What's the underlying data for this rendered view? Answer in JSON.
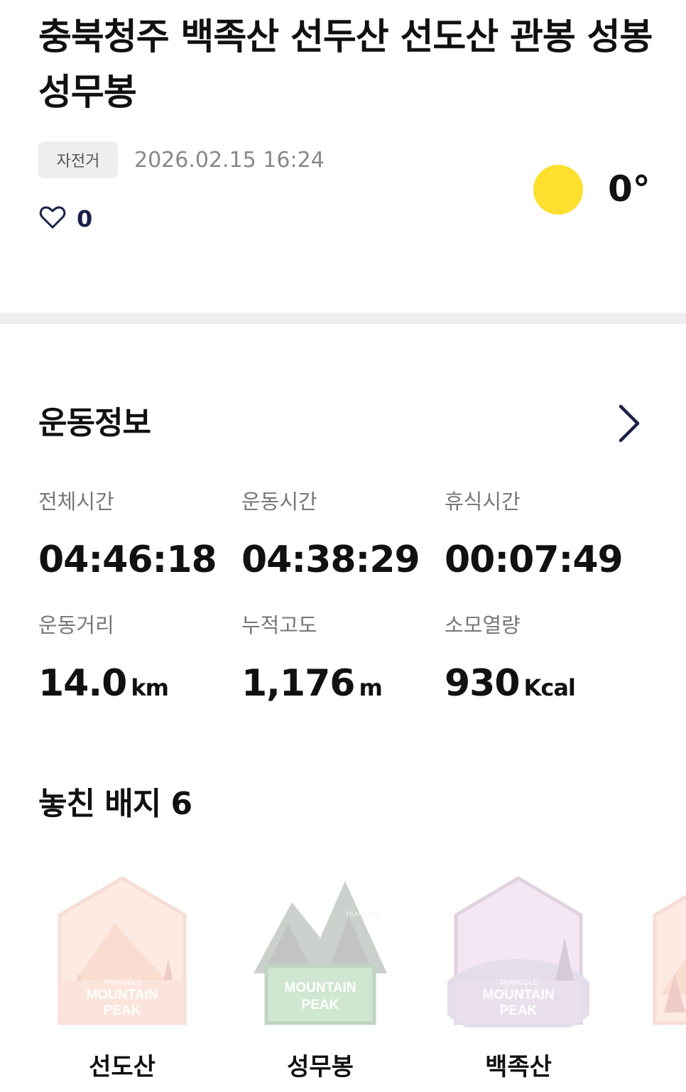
{
  "header": {
    "title": "충북청주 백족산 선두산 선도산 관봉 성봉 성무봉",
    "activity_tag": "자전거",
    "datetime": "2026.02.15 16:24",
    "likes": "0",
    "like_icon": "heart-outline-icon"
  },
  "weather": {
    "icon": "sun-icon",
    "icon_color": "#fde02e",
    "temperature": "0°"
  },
  "exercise_info": {
    "title": "운동정보",
    "more_icon": "chevron-right-icon",
    "accent_color": "#1a2148",
    "stats": [
      {
        "label": "전체시간",
        "value": "04:46:18",
        "unit": ""
      },
      {
        "label": "운동시간",
        "value": "04:38:29",
        "unit": ""
      },
      {
        "label": "휴식시간",
        "value": "00:07:49",
        "unit": ""
      },
      {
        "label": "운동거리",
        "value": "14.0",
        "unit": "km"
      },
      {
        "label": "누적고도",
        "value": "1,176",
        "unit": "m"
      },
      {
        "label": "소모열량",
        "value": "930",
        "unit": "Kcal"
      }
    ]
  },
  "missed_badges": {
    "title": "놓친 배지 6",
    "items": [
      {
        "name": "선도산",
        "badge_text_top": "TRANGGLE",
        "badge_text": "MOUNTAIN",
        "badge_text2": "PEAK"
      },
      {
        "name": "성무봉",
        "badge_text_top": "TRANGGLE",
        "badge_text": "MOUNTAIN",
        "badge_text2": "PEAK"
      },
      {
        "name": "백족산",
        "badge_text_top": "TRANGGLE",
        "badge_text": "MOUNTAIN",
        "badge_text2": "PEAK"
      }
    ]
  }
}
